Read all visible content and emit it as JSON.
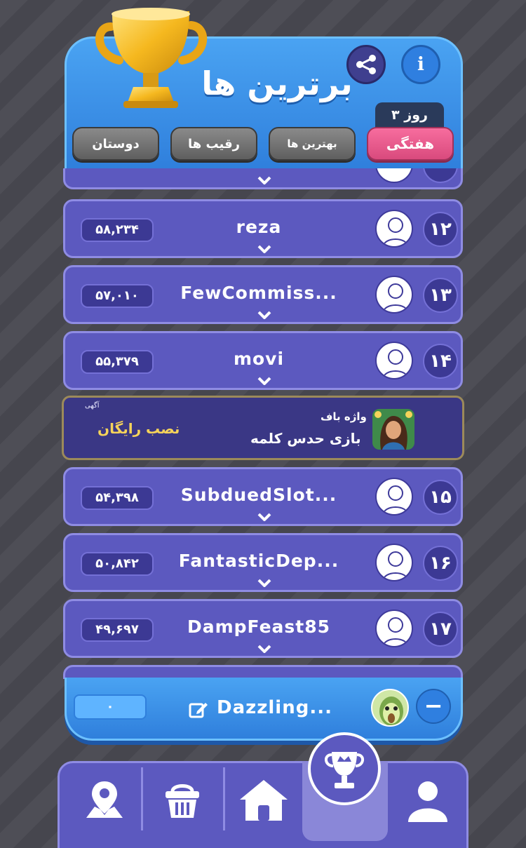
{
  "header": {
    "title": "برترین ها",
    "days_left": "۳ روز",
    "icons": [
      "trophy-icon",
      "share-icon",
      "info-icon"
    ],
    "info_label": "i"
  },
  "tabs": [
    {
      "label": "هفتگی",
      "active": true
    },
    {
      "label": "بهترین ها",
      "active": false
    },
    {
      "label": "رقیب ها",
      "active": false
    },
    {
      "label": "دوستان",
      "active": false
    }
  ],
  "rows": [
    {
      "rank": "۱۲",
      "name": "reza",
      "score": "۵۸,۲۳۴"
    },
    {
      "rank": "۱۳",
      "name": "FewCommiss...",
      "score": "۵۷,۰۱۰"
    },
    {
      "rank": "۱۴",
      "name": "movi",
      "score": "۵۵,۳۷۹"
    },
    {
      "rank": "۱۵",
      "name": "SubduedSlot...",
      "score": "۵۴,۳۹۸"
    },
    {
      "rank": "۱۶",
      "name": "FantasticDep...",
      "score": "۵۰,۸۴۲"
    },
    {
      "rank": "۱۷",
      "name": "DampFeast85",
      "score": "۴۹,۶۹۷"
    }
  ],
  "ad": {
    "label": "آگهی",
    "title": "واژه باف",
    "subtitle": "بازی حدس کلمه",
    "cta": "نصب رایگان"
  },
  "me": {
    "name": "Dazzling...",
    "score": "۰",
    "collapse_symbol": "−"
  },
  "nav": {
    "items": [
      "map-pin-icon",
      "basket-icon",
      "home-icon",
      "trophy-icon",
      "profile-icon"
    ],
    "active": "trophy-icon"
  },
  "colors": {
    "header_blue": "#3a8ee8",
    "row_purple": "#5c59bf",
    "active_tab_pink": "#e65a8c",
    "ad_gold": "#f5d35a"
  }
}
